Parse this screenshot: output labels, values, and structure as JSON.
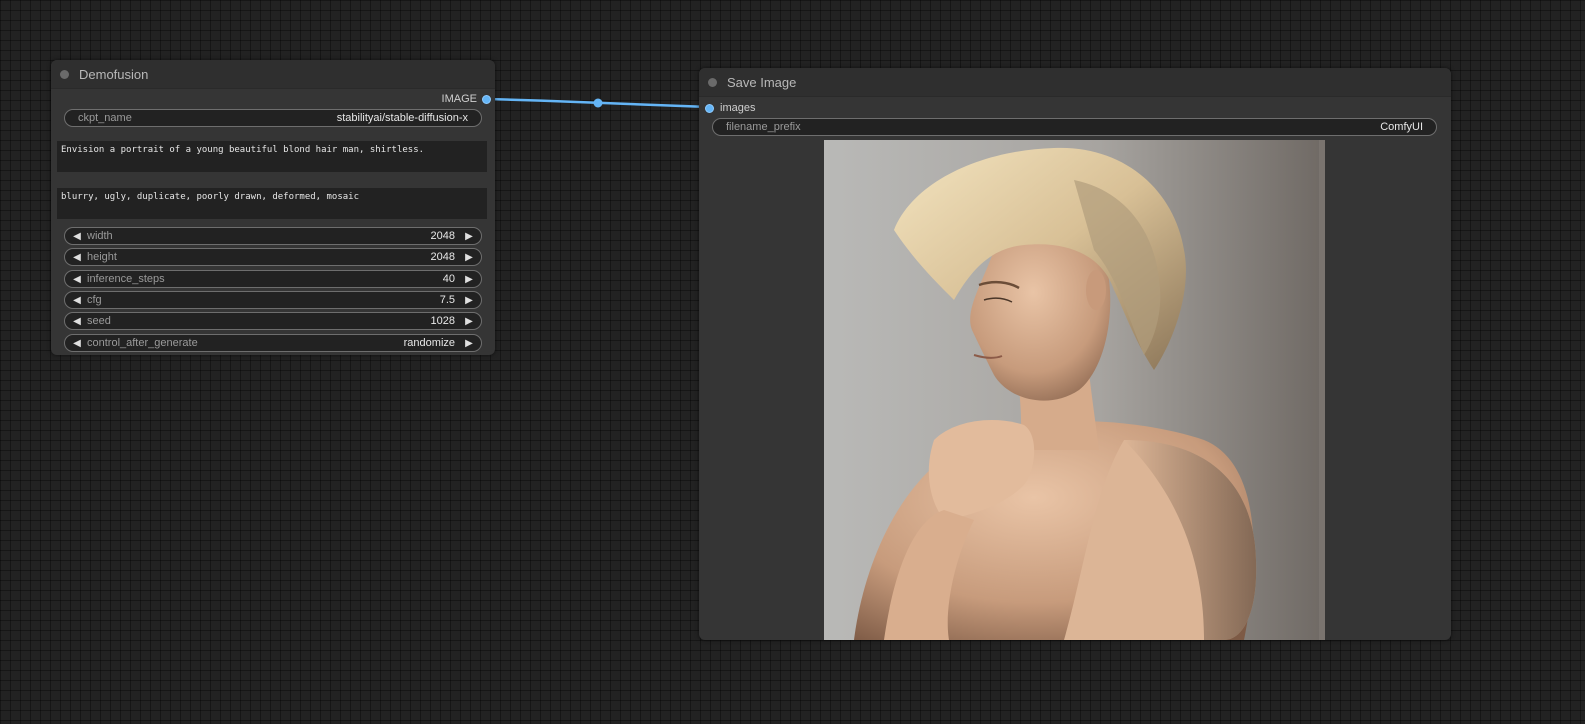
{
  "colors": {
    "canvas_bg": "#222222",
    "node_bg": "#353535",
    "link": "#64b5f6"
  },
  "demofusion": {
    "title": "Demofusion",
    "output_label": "IMAGE",
    "ckpt": {
      "label": "ckpt_name",
      "value": "stabilityai/stable-diffusion-x"
    },
    "positive_prompt": "Envision a portrait of a young beautiful blond hair man, shirtless.",
    "negative_prompt": "blurry, ugly, duplicate, poorly drawn, deformed, mosaic",
    "widgets": [
      {
        "label": "width",
        "value": "2048"
      },
      {
        "label": "height",
        "value": "2048"
      },
      {
        "label": "inference_steps",
        "value": "40"
      },
      {
        "label": "cfg",
        "value": "7.5"
      },
      {
        "label": "seed",
        "value": "1028"
      },
      {
        "label": "control_after_generate",
        "value": "randomize"
      }
    ],
    "arrow_left_icon": "triangle-left-icon",
    "arrow_right_icon": "triangle-right-icon"
  },
  "save_image": {
    "title": "Save Image",
    "input_label": "images",
    "filename_prefix": {
      "label": "filename_prefix",
      "value": "ComfyUI"
    },
    "preview_icon": "portrait-photo-image"
  }
}
